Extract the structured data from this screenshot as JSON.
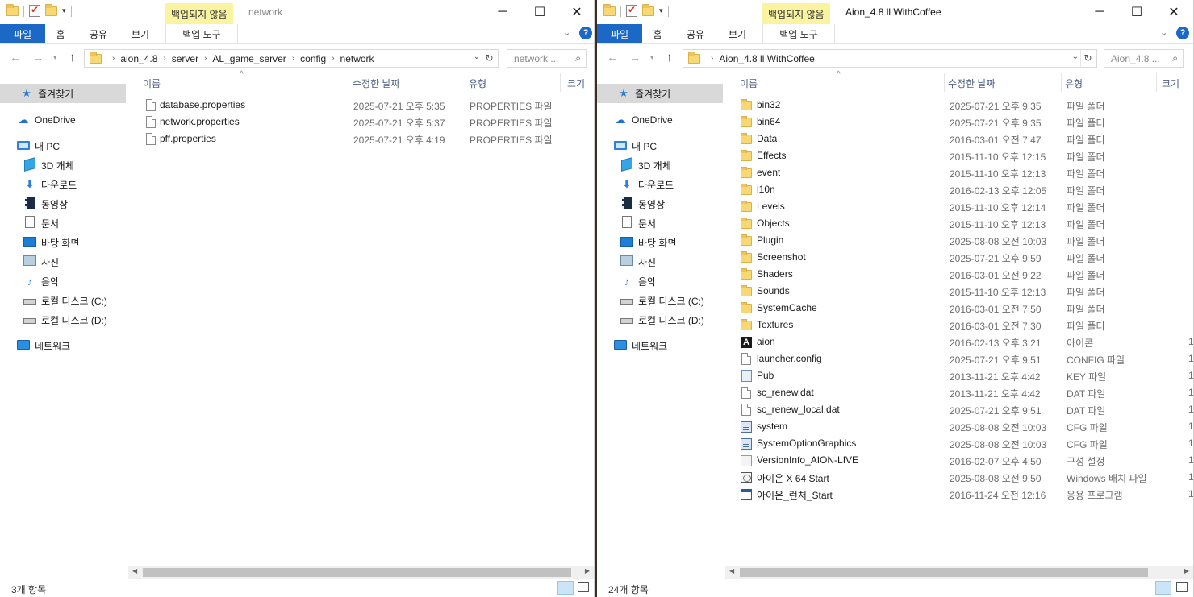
{
  "left": {
    "ctx_tab": "백업되지 않음",
    "title": "network",
    "ribbon": {
      "file": "파일",
      "home": "홈",
      "share": "공유",
      "view": "보기",
      "backup_tools": "백업 도구"
    },
    "breadcrumb": [
      "aion_4.8",
      "server",
      "AL_game_server",
      "config",
      "network"
    ],
    "search_placeholder": "network ...",
    "columns": {
      "name": "이름",
      "modified": "수정한 날짜",
      "type": "유형",
      "size": "크기"
    },
    "nav": {
      "quick_access": "즐겨찾기",
      "onedrive": "OneDrive",
      "this_pc": "내 PC",
      "objects3d": "3D 개체",
      "downloads": "다운로드",
      "videos": "동영상",
      "documents": "문서",
      "desktop": "바탕 화면",
      "pictures": "사진",
      "music": "음악",
      "drive_c": "로컬 디스크 (C:)",
      "drive_d": "로컬 디스크 (D:)",
      "network": "네트워크"
    },
    "files": [
      {
        "name": "database.properties",
        "date": "2025-07-21 오후 5:35",
        "type": "PROPERTIES 파일",
        "icon": "file"
      },
      {
        "name": "network.properties",
        "date": "2025-07-21 오후 5:37",
        "type": "PROPERTIES 파일",
        "icon": "file"
      },
      {
        "name": "pff.properties",
        "date": "2025-07-21 오후 4:19",
        "type": "PROPERTIES 파일",
        "icon": "file"
      }
    ],
    "status": "3개 항목"
  },
  "right": {
    "ctx_tab": "백업되지 않음",
    "title": "Aion_4.8 ll WithCoffee",
    "ribbon": {
      "file": "파일",
      "home": "홈",
      "share": "공유",
      "view": "보기",
      "backup_tools": "백업 도구"
    },
    "breadcrumb": [
      "Aion_4.8 ll WithCoffee"
    ],
    "search_placeholder": "Aion_4.8 ...",
    "columns": {
      "name": "이름",
      "modified": "수정한 날짜",
      "type": "유형",
      "size": "크기"
    },
    "nav": {
      "quick_access": "즐겨찾기",
      "onedrive": "OneDrive",
      "this_pc": "내 PC",
      "objects3d": "3D 개체",
      "downloads": "다운로드",
      "videos": "동영상",
      "documents": "문서",
      "desktop": "바탕 화면",
      "pictures": "사진",
      "music": "음악",
      "drive_c": "로컬 디스크 (C:)",
      "drive_d": "로컬 디스크 (D:)",
      "network": "네트워크"
    },
    "files": [
      {
        "name": "bin32",
        "date": "2025-07-21 오후 9:35",
        "type": "파일 폴더",
        "icon": "folder"
      },
      {
        "name": "bin64",
        "date": "2025-07-21 오후 9:35",
        "type": "파일 폴더",
        "icon": "folder"
      },
      {
        "name": "Data",
        "date": "2016-03-01 오전 7:47",
        "type": "파일 폴더",
        "icon": "folder"
      },
      {
        "name": "Effects",
        "date": "2015-11-10 오후 12:15",
        "type": "파일 폴더",
        "icon": "folder"
      },
      {
        "name": "event",
        "date": "2015-11-10 오후 12:13",
        "type": "파일 폴더",
        "icon": "folder"
      },
      {
        "name": "l10n",
        "date": "2016-02-13 오후 12:05",
        "type": "파일 폴더",
        "icon": "folder"
      },
      {
        "name": "Levels",
        "date": "2015-11-10 오후 12:14",
        "type": "파일 폴더",
        "icon": "folder"
      },
      {
        "name": "Objects",
        "date": "2015-11-10 오후 12:13",
        "type": "파일 폴더",
        "icon": "folder"
      },
      {
        "name": "Plugin",
        "date": "2025-08-08 오전 10:03",
        "type": "파일 폴더",
        "icon": "folder"
      },
      {
        "name": "Screenshot",
        "date": "2025-07-21 오후 9:59",
        "type": "파일 폴더",
        "icon": "folder"
      },
      {
        "name": "Shaders",
        "date": "2016-03-01 오전 9:22",
        "type": "파일 폴더",
        "icon": "folder"
      },
      {
        "name": "Sounds",
        "date": "2015-11-10 오후 12:13",
        "type": "파일 폴더",
        "icon": "folder"
      },
      {
        "name": "SystemCache",
        "date": "2016-03-01 오전 7:50",
        "type": "파일 폴더",
        "icon": "folder"
      },
      {
        "name": "Textures",
        "date": "2016-03-01 오전 7:30",
        "type": "파일 폴더",
        "icon": "folder"
      },
      {
        "name": "aion",
        "date": "2016-02-13 오후 3:21",
        "type": "아이콘",
        "icon": "aion"
      },
      {
        "name": "launcher.config",
        "date": "2025-07-21 오후 9:51",
        "type": "CONFIG 파일",
        "icon": "file"
      },
      {
        "name": "Pub",
        "date": "2013-11-21 오후 4:42",
        "type": "KEY 파일",
        "icon": "key"
      },
      {
        "name": "sc_renew.dat",
        "date": "2013-11-21 오후 4:42",
        "type": "DAT 파일",
        "icon": "file"
      },
      {
        "name": "sc_renew_local.dat",
        "date": "2025-07-21 오후 9:51",
        "type": "DAT 파일",
        "icon": "file"
      },
      {
        "name": "system",
        "date": "2025-08-08 오전 10:03",
        "type": "CFG 파일",
        "icon": "cfg"
      },
      {
        "name": "SystemOptionGraphics",
        "date": "2025-08-08 오전 10:03",
        "type": "CFG 파일",
        "icon": "cfg"
      },
      {
        "name": "VersionInfo_AION-LIVE",
        "date": "2016-02-07 오후 4:50",
        "type": "구성 설정",
        "icon": "ini"
      },
      {
        "name": "아이온 X 64 Start",
        "date": "2025-08-08 오전 9:50",
        "type": "Windows 배치 파일",
        "icon": "bat"
      },
      {
        "name": "아이온_런처_Start",
        "date": "2016-11-24 오전 12:16",
        "type": "응용 프로그램",
        "icon": "exe"
      }
    ],
    "size_peek": "1",
    "status": "24개 항목"
  }
}
